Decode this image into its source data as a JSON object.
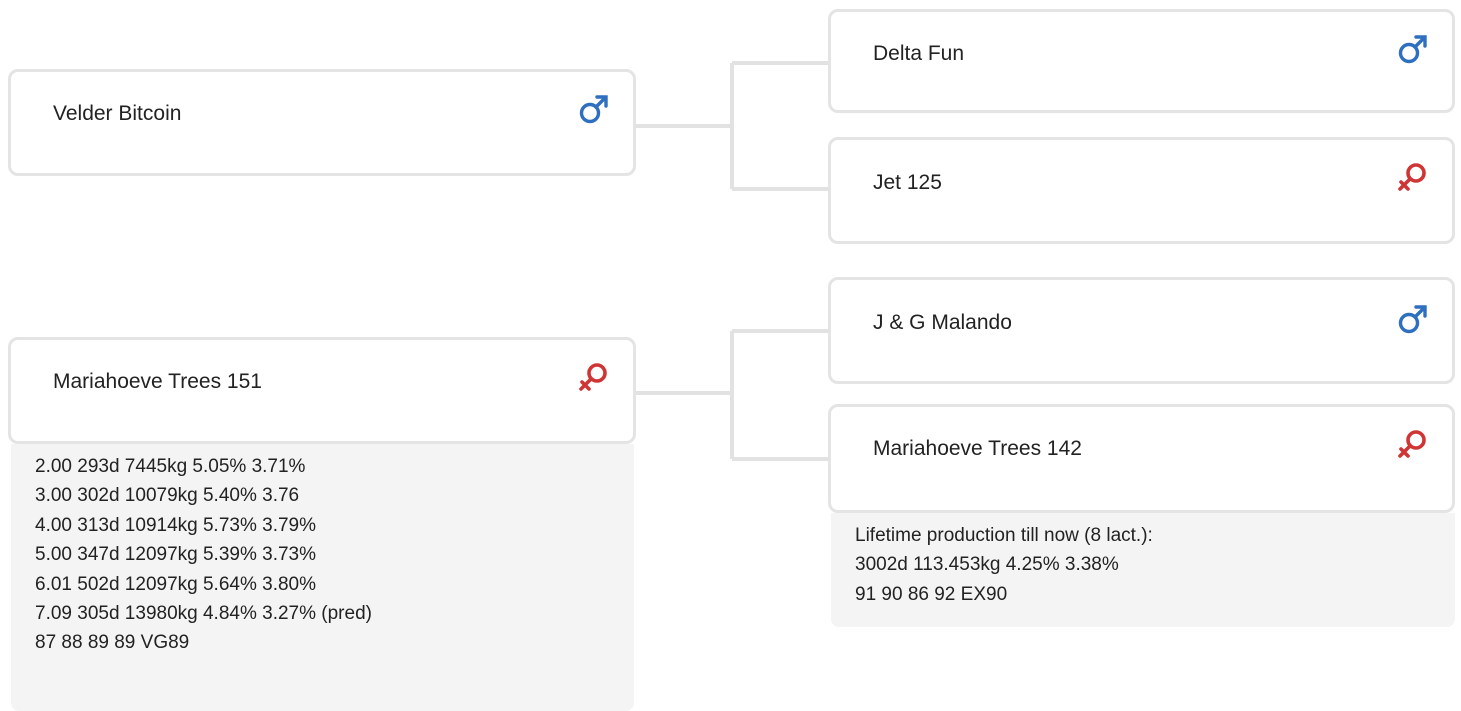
{
  "colors": {
    "male": "#2e6fbf",
    "female": "#d03535",
    "card_border": "#e4e4e4",
    "connector": "#e2e2e2",
    "info_bg": "#f4f4f4"
  },
  "pedigree": {
    "sire": {
      "name": "Velder Bitcoin",
      "sex": "male",
      "sex_icon": "male-symbol-icon",
      "sire": {
        "name": "Delta Fun",
        "sex": "male",
        "sex_icon": "male-symbol-icon"
      },
      "dam": {
        "name": "Jet 125",
        "sex": "female",
        "sex_icon": "female-symbol-icon"
      }
    },
    "dam": {
      "name": "Mariahoeve Trees 151",
      "sex": "female",
      "sex_icon": "female-symbol-icon",
      "production": [
        "2.00 293d 7445kg 5.05% 3.71%",
        "3.00 302d 10079kg 5.40% 3.76",
        "4.00 313d 10914kg 5.73% 3.79%",
        "5.00 347d 12097kg 5.39% 3.73%",
        "6.01 502d 12097kg 5.64% 3.80%",
        "7.09 305d 13980kg 4.84% 3.27% (pred)",
        "87 88 89 89 VG89"
      ],
      "sire": {
        "name": "J & G Malando",
        "sex": "male",
        "sex_icon": "male-symbol-icon"
      },
      "dam": {
        "name": "Mariahoeve Trees 142",
        "sex": "female",
        "sex_icon": "female-symbol-icon",
        "production": [
          "Lifetime production till now (8 lact.):",
          "3002d 113.453kg 4.25% 3.38%",
          "91 90 86 92 EX90"
        ]
      }
    }
  }
}
